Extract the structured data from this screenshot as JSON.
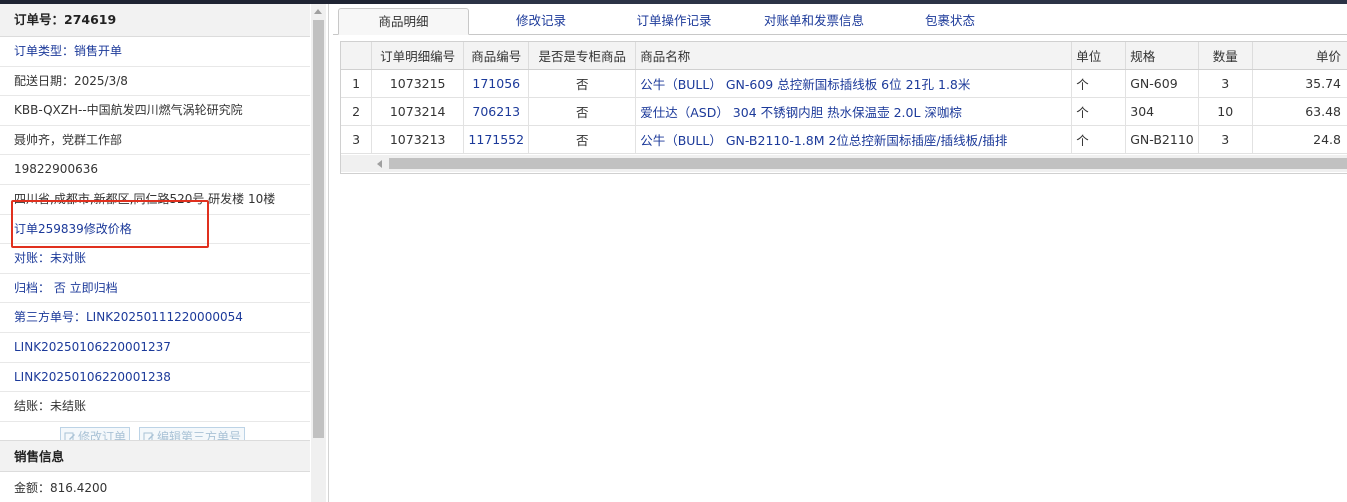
{
  "order": {
    "title": "订单号：274619",
    "rows": [
      {
        "text": "订单类型：销售开单",
        "style": "blue"
      },
      {
        "text": "配送日期：2025/3/8",
        "style": "dark"
      },
      {
        "text": "KBB-QXZH--中国航发四川燃气涡轮研究院",
        "style": "dark"
      },
      {
        "text": "聂帅齐，党群工作部",
        "style": "dark"
      },
      {
        "text": "19822900636",
        "style": "dark"
      },
      {
        "text": "四川省,成都市,新都区,同仁路520号 研发楼 10楼",
        "style": "dark"
      },
      {
        "text": "订单259839修改价格",
        "style": "blue"
      },
      {
        "text": "对账：未对账",
        "style": "blue"
      },
      {
        "text": "归档： 否 立即归档",
        "style": "blue"
      },
      {
        "text": "第三方单号：LINK20250111220000054",
        "style": "blue"
      },
      {
        "text": "LINK20250106220001237",
        "style": "blue"
      },
      {
        "text": "LINK20250106220001238",
        "style": "blue"
      },
      {
        "text": "结账：未结账",
        "style": "dark"
      }
    ],
    "buttons": {
      "edit_order": "修改订单",
      "edit_third": "编辑第三方单号"
    }
  },
  "sales": {
    "title": "销售信息",
    "amount": "金额：816.4200"
  },
  "tabs": [
    "商品明细",
    "修改记录",
    "订单操作记录",
    "对账单和发票信息",
    "包裹状态"
  ],
  "grid": {
    "columns": [
      "",
      "订单明细编号",
      "商品编号",
      "是否是专柜商品",
      "商品名称",
      "单位",
      "规格",
      "数量",
      "单价"
    ],
    "rows": [
      [
        "1",
        "1073215",
        "171056",
        "否",
        "公牛（BULL） GN-609 总控新国标插线板 6位 21孔 1.8米",
        "个",
        "GN-609",
        "3",
        "35.74"
      ],
      [
        "2",
        "1073214",
        "706213",
        "否",
        "爱仕达（ASD） 304 不锈钢内胆 热水保温壶 2.0L 深咖棕",
        "个",
        "304",
        "10",
        "63.48"
      ],
      [
        "3",
        "1073213",
        "1171552",
        "否",
        "公牛（BULL） GN-B2110-1.8M 2位总控新国标插座/插线板/插排",
        "个",
        "GN-B2110",
        "3",
        "24.8"
      ]
    ]
  },
  "colors": {
    "link": "#1c3a9a",
    "highlight": "#e0301e"
  }
}
